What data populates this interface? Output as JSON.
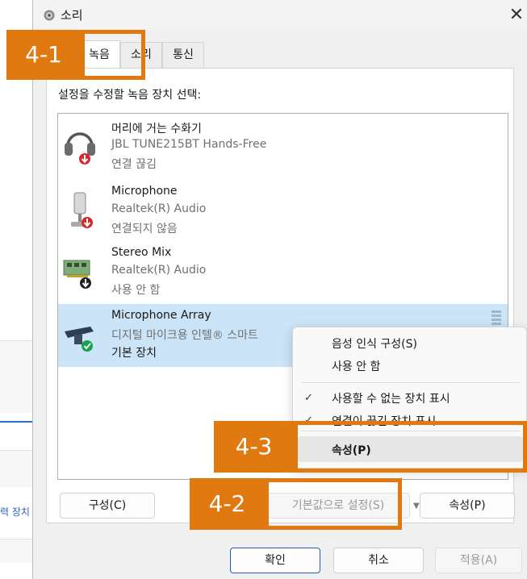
{
  "background_app": {
    "partial_text": "력 장치"
  },
  "window": {
    "title": "소리",
    "close_glyph": "✕"
  },
  "tabs": [
    {
      "label": "녹음",
      "active": true
    },
    {
      "label": "소리",
      "active": false
    },
    {
      "label": "통신",
      "active": false
    }
  ],
  "instruction": "설정을 수정할 녹음 장치 선택:",
  "devices": [
    {
      "name": "머리에 거는 수화기",
      "driver": "JBL TUNE215BT Hands-Free",
      "status": "연결 끊김",
      "icon": "headset-icon",
      "badge": "red-down-arrow",
      "selected": false
    },
    {
      "name": "Microphone",
      "driver": "Realtek(R) Audio",
      "status": "연결되지 않음",
      "icon": "microphone-icon",
      "badge": "red-down-arrow",
      "selected": false
    },
    {
      "name": "Stereo Mix",
      "driver": "Realtek(R) Audio",
      "status": "사용 안 함",
      "icon": "circuit-board-icon",
      "badge": "black-down-arrow",
      "selected": false
    },
    {
      "name": "Microphone Array",
      "driver": "디지털 마이크용 인텔® 스마트",
      "status": "기본 장치",
      "icon": "mic-array-icon",
      "badge": "green-check",
      "selected": true
    }
  ],
  "context_menu": {
    "items": [
      {
        "label": "음성 인식 구성(S)",
        "checked": false
      },
      {
        "label": "사용 안 함",
        "checked": false
      },
      {
        "label": "사용할 수 없는 장치 표시",
        "checked": true
      },
      {
        "label": "연결이 끊긴 장치 표시",
        "checked": true
      },
      {
        "label": "속성(P)",
        "checked": false,
        "highlighted": true
      }
    ],
    "check_glyph": "✓"
  },
  "buttons": {
    "configure": "구성(C)",
    "set_default": "기본값으로 설정(S)",
    "properties": "속성(P)",
    "ok": "확인",
    "cancel": "취소",
    "apply": "적용(A)"
  },
  "annotations": [
    "4-1",
    "4-2",
    "4-3"
  ],
  "colors": {
    "annotation": "#e07a10",
    "selection": "#cce4f7",
    "primary_border": "#1f5fb8",
    "status_red": "#d9262c",
    "status_green": "#16a34a"
  }
}
